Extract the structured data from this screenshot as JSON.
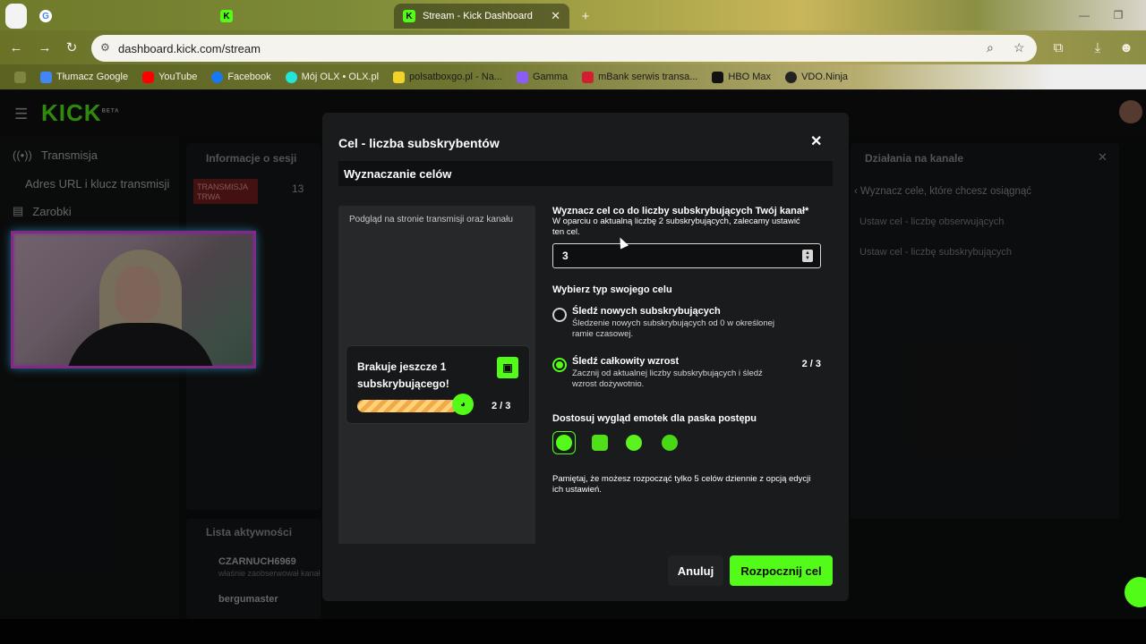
{
  "browser": {
    "tabs": [
      {
        "title": "",
        "icon": "google-icon"
      },
      {
        "title": "Stream - Kick Dashboard",
        "icon": "kick-icon"
      }
    ],
    "url": "dashboard.kick.com/stream",
    "bookmarks": [
      "Tłumacz Google",
      "YouTube",
      "Facebook",
      "Mój OLX • OLX.pl",
      "polsatboxgo.pl - Na...",
      "Gamma",
      "mBank serwis transa...",
      "HBO Max",
      "VDO.Ninja"
    ]
  },
  "dashboard": {
    "logo": "KICK",
    "logo_badge": "BETA",
    "left_nav": [
      {
        "label": "Transmisja",
        "icon": "broadcast-icon"
      },
      {
        "label": "Adres URL i klucz transmisji",
        "icon": ""
      },
      {
        "label": "Zarobki",
        "icon": "chart-icon"
      }
    ],
    "session_panel_title": "Informacje o sesji",
    "live_badge": "TRANSMISJA TRWA",
    "session_value": "13",
    "activity_title": "Lista aktywności",
    "activity_items": [
      {
        "user": "CZARNUCH6969",
        "text": "właśnie zaobserwował kanał"
      },
      {
        "user": "bergumaster",
        "text": ""
      }
    ],
    "right_panel_title": "Działania na kanale",
    "right_panel_back": "Wyznacz cele, które chcesz osiągnąć",
    "right_panel_items": [
      "Ustaw cel - liczbę obserwujących",
      "Ustaw cel - liczbę subskrybujących"
    ]
  },
  "modal": {
    "title": "Cel - liczba subskrybentów",
    "section": "Wyznaczanie celów",
    "preview_label": "Podgląd na stronie transmisji oraz kanału",
    "goal_card": {
      "text": "Brakuje jeszcze 1 subskrybującego!",
      "count": "2 / 3",
      "progress": 0.67
    },
    "target_label": "Wyznacz cel co do liczby subskrybujących Twój kanał*",
    "target_help": "W oparciu o aktualną liczbę 2 subskrybujących, zalecamy ustawić ten cel.",
    "target_value": "3",
    "type_label": "Wybierz typ swojego celu",
    "options": [
      {
        "title": "Śledź nowych subskrybujących",
        "desc": "Śledzenie nowych subskrybujących od 0 w określonej ramie czasowej.",
        "selected": false,
        "count": ""
      },
      {
        "title": "Śledź całkowity wzrost",
        "desc": "Zacznij od aktualnej liczby subskrybujących i śledź wzrost dożywotnio.",
        "selected": true,
        "count": "2 / 3"
      }
    ],
    "emote_label": "Dostosuj wygląd emotek dla paska postępu",
    "emotes": [
      "emote-1-icon",
      "emote-2-icon",
      "emote-3-icon",
      "emote-4-icon"
    ],
    "note": "Pamiętaj, że możesz rozpocząć tylko 5 celów dziennie z opcją edycji ich ustawień.",
    "cancel": "Anuluj",
    "start": "Rozpocznij cel"
  },
  "colors": {
    "accent": "#53fc18",
    "modal_bg": "#191b1c"
  }
}
